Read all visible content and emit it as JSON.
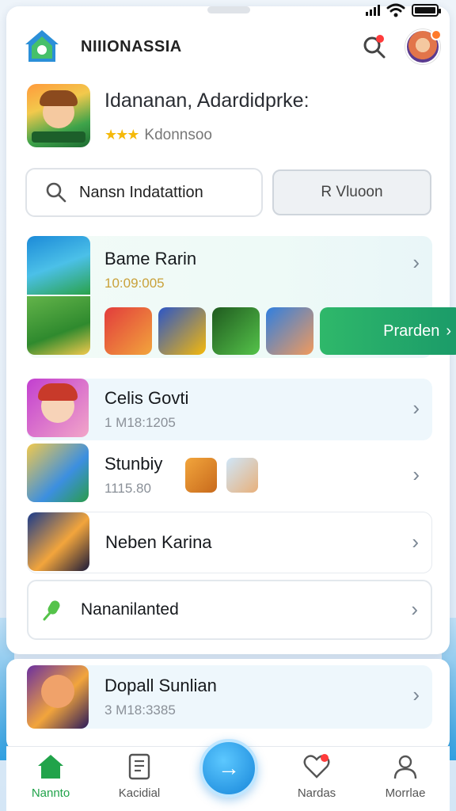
{
  "app": {
    "brand": "NIIIONASSIA"
  },
  "featured": {
    "title": "Idananan, Adardidprke:",
    "rating_stars": "★★★",
    "subtitle": "Kdonnsoo"
  },
  "search": {
    "label": "Nansn Indatattion",
    "side_button": "R Vluoon"
  },
  "rows": [
    {
      "title": "Bame Rarin",
      "meta": "10:09:005",
      "promo_label": "Prarden"
    },
    {
      "title": "Celis Govti",
      "meta": "1 M18:1205"
    },
    {
      "title": "Stunbiy",
      "meta": "1115.80"
    },
    {
      "title": "Neben Karina"
    },
    {
      "title": "Nananilanted"
    },
    {
      "title": "Dopall Sunlian",
      "meta": "3 M18:3385"
    }
  ],
  "nav": [
    {
      "label": "Nannto",
      "icon": "home-icon",
      "active": true
    },
    {
      "label": "Kacidial",
      "icon": "document-icon"
    },
    {
      "label": "",
      "icon": "arrow-right-icon"
    },
    {
      "label": "Nardas",
      "icon": "heart-icon"
    },
    {
      "label": "Morrlae",
      "icon": "user-icon"
    }
  ],
  "colors": {
    "accent": "#21a34a",
    "fab": "#1685d9",
    "badge": "#ff3b3b"
  }
}
